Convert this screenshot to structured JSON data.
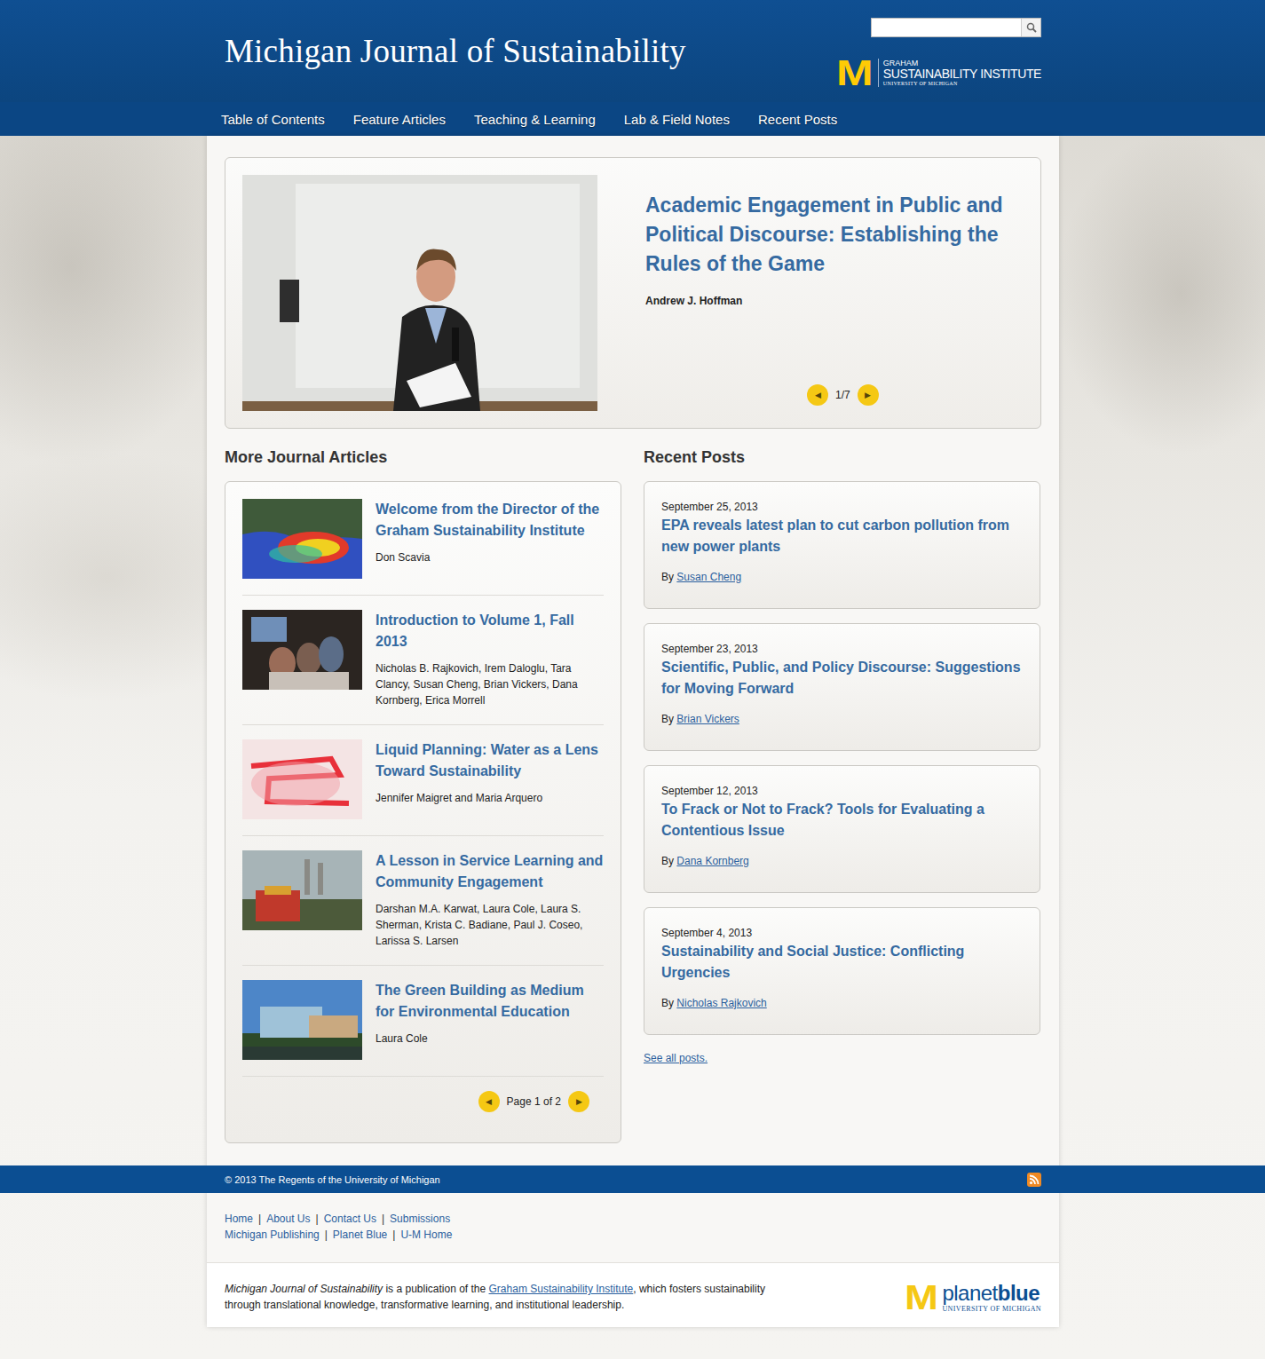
{
  "header": {
    "title": "Michigan Journal of Sustainability",
    "search": {
      "placeholder": ""
    },
    "logo": {
      "mark": "M",
      "line1": "GRAHAM",
      "line2": "SUSTAINABILITY INSTITUTE",
      "line3": "UNIVERSITY OF MICHIGAN"
    }
  },
  "nav": [
    {
      "label": "Table of Contents"
    },
    {
      "label": "Feature Articles"
    },
    {
      "label": "Teaching & Learning"
    },
    {
      "label": "Lab & Field Notes"
    },
    {
      "label": "Recent Posts"
    }
  ],
  "feature": {
    "title": "Academic Engagement in Public and Political Discourse: Establishing the Rules of the Game",
    "author": "Andrew J. Hoffman",
    "pager": {
      "prev": "◀",
      "count": "1/7",
      "next": "▶"
    }
  },
  "articles": {
    "heading": "More Journal Articles",
    "items": [
      {
        "title": "Welcome from the Director of the Graham Sustainability Institute",
        "authors": "Don Scavia"
      },
      {
        "title": "Introduction to Volume 1, Fall 2013",
        "authors": "Nicholas B. Rajkovich, Irem Daloglu, Tara Clancy, Susan Cheng, Brian Vickers, Dana Kornberg, Erica Morrell"
      },
      {
        "title": "Liquid Planning: Water as a Lens Toward Sustainability",
        "authors": "Jennifer Maigret and Maria Arquero"
      },
      {
        "title": "A Lesson in Service Learning and Community Engagement",
        "authors": "Darshan M.A. Karwat, Laura Cole, Laura S. Sherman, Krista C. Badiane, Paul J. Coseo, Larissa S. Larsen"
      },
      {
        "title": "The Green Building as Medium for Environmental Education",
        "authors": "Laura Cole"
      }
    ],
    "pager": {
      "prev": "◀",
      "label": "Page 1 of 2",
      "next": "▶"
    }
  },
  "posts": {
    "heading": "Recent Posts",
    "items": [
      {
        "date": "September 25, 2013",
        "title": "EPA reveals latest plan to cut carbon pollution from new power plants",
        "by": "By",
        "author": "Susan Cheng"
      },
      {
        "date": "September 23, 2013",
        "title": "Scientific, Public, and Policy Discourse: Suggestions for Moving Forward",
        "by": "By",
        "author": "Brian Vickers"
      },
      {
        "date": "September 12, 2013",
        "title": "To Frack or Not to Frack? Tools for Evaluating a Contentious Issue",
        "by": "By",
        "author": "Dana Kornberg"
      },
      {
        "date": "September 4, 2013",
        "title": "Sustainability and Social Justice: Conflicting Urgencies",
        "by": "By",
        "author": "Nicholas Rajkovich"
      }
    ],
    "see_all": "See all posts."
  },
  "footer": {
    "copyright": "© 2013 The Regents of the University of Michigan",
    "separator": "|",
    "links": [
      [
        "Home",
        "About Us",
        "Contact Us",
        "Submissions"
      ],
      [
        "Michigan Publishing",
        "Planet Blue",
        "U-M Home"
      ]
    ],
    "about": {
      "journal": "Michigan Journal of Sustainability",
      "text1": " is a publication of the ",
      "link": "Graham Sustainability Institute",
      "text2": ", which fosters sustainability through translational knowledge, transformative learning, and institutional leadership."
    },
    "logo": {
      "mark": "M",
      "word1": "planet",
      "word2": "blue",
      "sub": "UNIVERSITY OF MICHIGAN"
    }
  }
}
